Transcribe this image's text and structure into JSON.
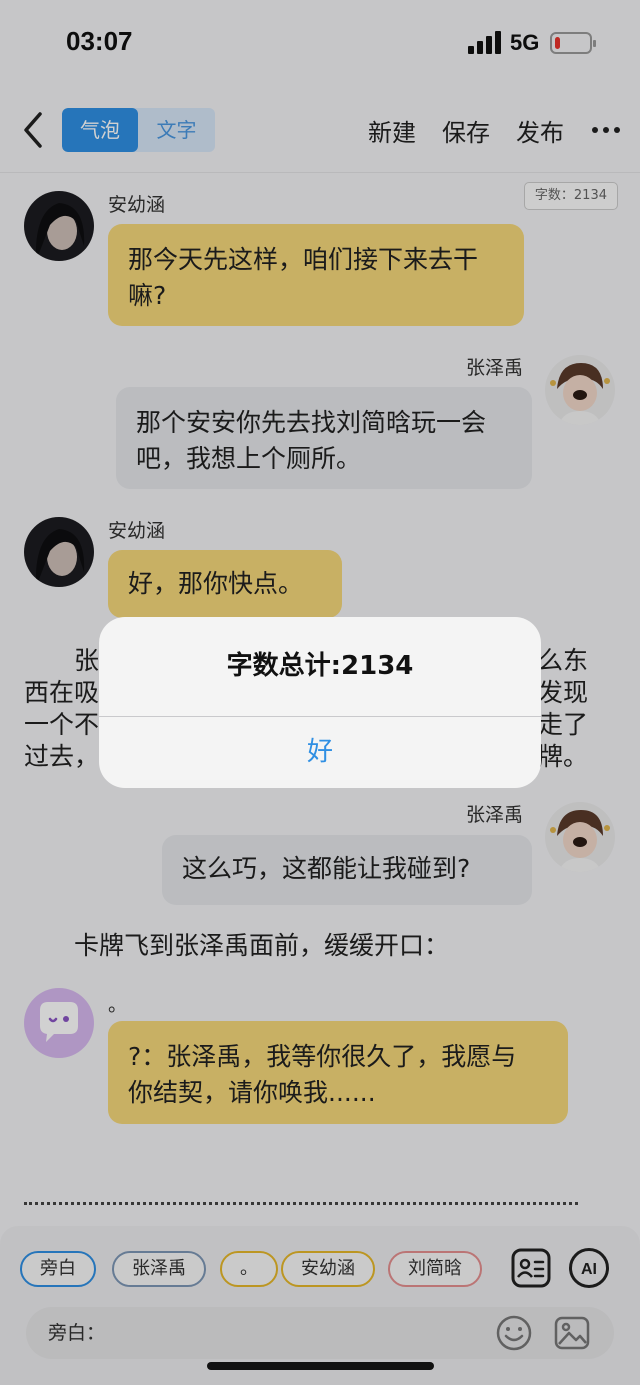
{
  "status_bar": {
    "time": "03:07",
    "network": "5G",
    "battery_level_fraction": 0.15,
    "battery_color": "#e8332b"
  },
  "nav": {
    "tabs": [
      "气泡",
      "文字"
    ],
    "active_tab": "气泡",
    "actions": {
      "new": "新建",
      "save": "保存",
      "publish": "发布"
    }
  },
  "word_count_badge": "字数：2134",
  "messages": [
    {
      "type": "bubble",
      "side": "left",
      "speaker": "安幼涵",
      "avatar": "dark-haired-girl-avatar",
      "color": "#f5d77a",
      "lines": [
        "那今天先这样，咱们接下来去干",
        "嘛?"
      ]
    },
    {
      "type": "bubble",
      "side": "right",
      "speaker": "张泽禹",
      "avatar": "boy-with-dog-filter-avatar",
      "color": "#e4e6ea",
      "lines": [
        "那个安安你先去找刘简晗玩一会",
        "吧，我想上个厕所。"
      ]
    },
    {
      "type": "bubble",
      "side": "left",
      "speaker": "安幼涵",
      "avatar": "dark-haired-girl-avatar",
      "color": "#f5d77a",
      "lines": [
        "好，那你快点。"
      ]
    },
    {
      "type": "narration",
      "lines": [
        "　　张",
        "西在吸",
        "一个不",
        "过去，"
      ],
      "right_fragments": [
        "么东",
        "发现",
        "走了",
        "牌。"
      ]
    },
    {
      "type": "bubble",
      "side": "right",
      "speaker": "张泽禹",
      "avatar": "boy-with-dog-filter-avatar",
      "color": "#e4e6ea",
      "lines": [
        "这么巧，这都能让我碰到?"
      ]
    },
    {
      "type": "narration",
      "lines": [
        "　　卡牌飞到张泽禹面前，缓缓开口："
      ]
    },
    {
      "type": "bubble",
      "side": "left",
      "speaker": "。",
      "avatar": "chat-bubble-avatar",
      "color": "#f5d77a",
      "lines": [
        "?：张泽禹，我等你很久了，我愿与",
        "你结契，请你唤我......"
      ]
    }
  ],
  "alert": {
    "title": "字数总计:2134",
    "button": "好"
  },
  "role_chips": [
    {
      "label": "旁白",
      "border": "#2f8fe3",
      "active": true
    },
    {
      "label": "张泽禹",
      "border": "#7d97b5",
      "active": false
    },
    {
      "label": "。",
      "border": "#e6b82a",
      "active": false
    },
    {
      "label": "安幼涵",
      "border": "#e6b82a",
      "active": false
    },
    {
      "label": "刘简晗",
      "border": "#e58f8f",
      "active": false
    }
  ],
  "tools": {
    "role_card_icon": "id-card-icon",
    "ai_label": "AI"
  },
  "input": {
    "label": "旁白：",
    "emoji_icon": "smiley-icon",
    "image_icon": "image-icon"
  }
}
